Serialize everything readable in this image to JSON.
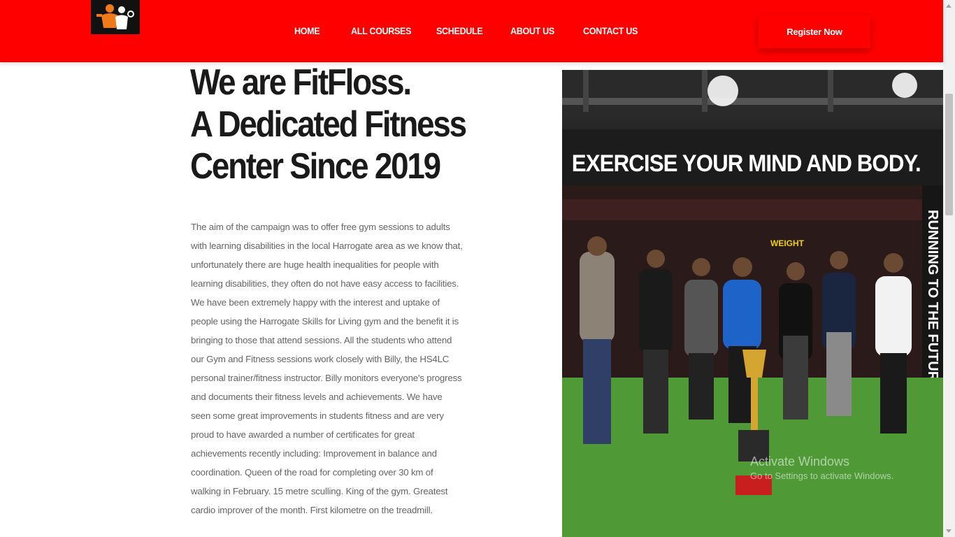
{
  "header": {
    "nav": [
      {
        "label": "HOME"
      },
      {
        "label": "ALL COURSES"
      },
      {
        "label": "SCHEDULE"
      },
      {
        "label": "ABOUT US"
      },
      {
        "label": "CONTACT US"
      }
    ],
    "register_label": "Register Now",
    "logo_icon": "fitness-logo-icon"
  },
  "hero": {
    "title_lines": [
      "We are FitFloss.",
      "A Dedicated Fitness",
      "Center Since 2019"
    ],
    "body": "The aim of the campaign was to offer free gym sessions to adults with learning disabilities in the local Harrogate area as we know that, unfortunately there are huge health inequalities for people with learning disabilities, they often do not have easy access to facilities. We have been extremely happy with the interest and uptake of people using the Harrogate Skills for Living gym and the benefit it is bringing to those that attend sessions. All the students who attend our Gym and Fitness sessions work closely with Billy, the HS4LC personal trainer/fitness instructor. Billy monitors everyone's progress and documents their fitness levels and achievements. We have seen some great improvements in students fitness and are very proud to have awarded a number of certificates for great achievements recently including: Improvement in balance and coordination. Queen of the road for completing over 30 km of walking in February. 15 metre sculling. King of the gym. Greatest cardio improver of the month. First kilometre on the treadmill."
  },
  "photo": {
    "wall_text": "EXERCISE YOUR MIND AND BODY.",
    "side_text": "RUNNING TO THE FUTURE",
    "sign_text": "WEIGHT"
  },
  "watermark": {
    "line1": "Activate Windows",
    "line2": "Go to Settings to activate Windows."
  },
  "colors": {
    "brand": "#ff0000",
    "title": "#1a1a1a",
    "body_text": "#666666"
  }
}
